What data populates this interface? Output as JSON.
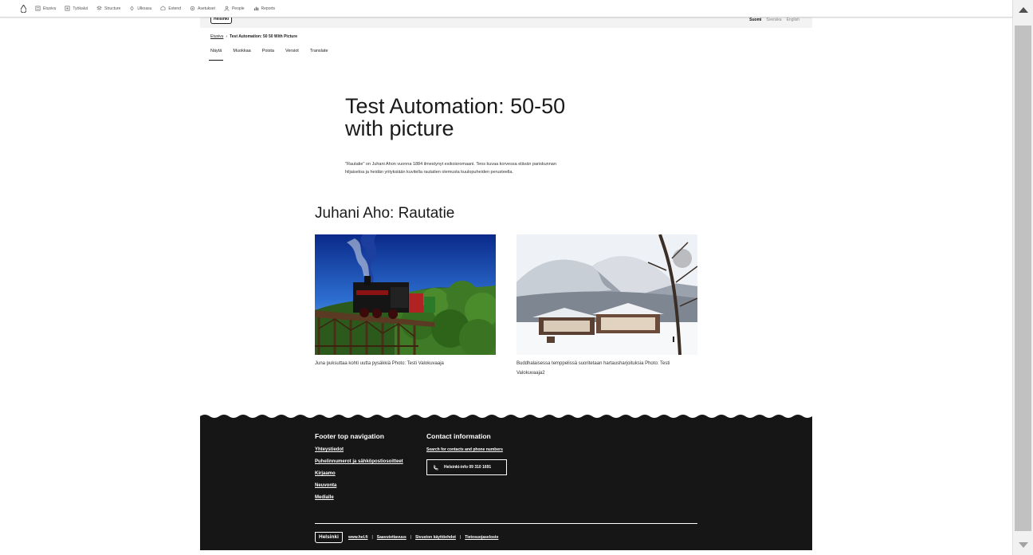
{
  "admin_toolbar": {
    "items": [
      {
        "label": "Etusivu",
        "icon": "home-icon"
      },
      {
        "label": "Työkalut",
        "icon": "tools-icon"
      },
      {
        "label": "Structure",
        "icon": "structure-icon"
      },
      {
        "label": "Ulkoasu",
        "icon": "appearance-icon"
      },
      {
        "label": "Extend",
        "icon": "extend-icon"
      },
      {
        "label": "Asetukset",
        "icon": "config-icon"
      },
      {
        "label": "People",
        "icon": "people-icon"
      },
      {
        "label": "Reports",
        "icon": "reports-icon"
      }
    ]
  },
  "header": {
    "logo": "Helsinki",
    "languages": [
      "Suomi",
      "Svenska",
      "English"
    ],
    "active_language": "Suomi"
  },
  "breadcrumb": {
    "home": "Etusivu",
    "separator": "›",
    "current": "Test Automation: 50 50 With Picture"
  },
  "tabs": [
    "Näytä",
    "Muokkaa",
    "Poista",
    "Versiot",
    "Translate"
  ],
  "page": {
    "title": "Test Automation: 50-50 with picture",
    "lead": "\"Rautatie\" on Juhani Ahon vuonna 1884 ilmestynyt esikoisromaani. Teos kuvaa korvessa elävän pariskunnan hiljaiseloa ja heidän yrityksiään kuvitella rautatien olemusta kuulopuheiden perusteella.",
    "section_title": "Juhani Aho: Rautatie",
    "figures": [
      {
        "caption": "Juna puksuttaa kohti uutta pysäkkiä Photo: Testi Valokuvaaja"
      },
      {
        "caption": "Buddhalaisessa temppelissä suoritetaan hartausharjoituksia Photo: Testi Valokuvaaja2"
      }
    ]
  },
  "footer": {
    "nav_title": "Footer top navigation",
    "nav_links": [
      "Yhteystiedot",
      "Puhelinnumerot ja sähköpostiosoitteet",
      "Kirjaamo",
      "Neuvonta",
      "Medialle"
    ],
    "contact_title": "Contact information",
    "contact_link": "Search for contacts and phone numbers",
    "phone_label": "Helsinki-info 09 310 1691",
    "logo": "Helsinki",
    "bottom_links": [
      "www.hel.fi",
      "Saavutettavuus",
      "Sivuston käyttöehdot",
      "Tietosuojaseloste"
    ]
  }
}
